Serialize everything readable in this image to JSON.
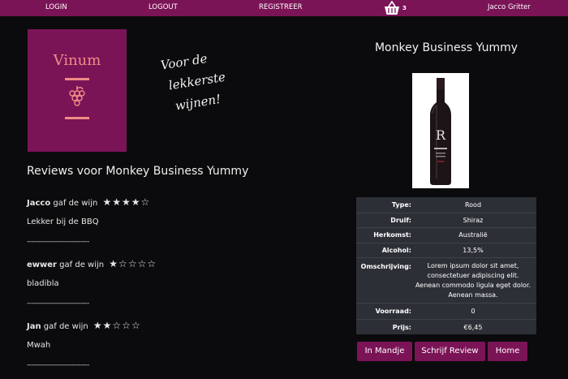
{
  "nav": {
    "login": "LOGIN",
    "logout": "LOGOUT",
    "register": "REGISTREER",
    "cart_count": "3",
    "user_name": "Jacco Gritter"
  },
  "logo": {
    "text": "Vinum"
  },
  "slogan": {
    "lines": [
      "Voor de",
      "lekkerste",
      "wijnen!"
    ]
  },
  "reviews": {
    "title": "Reviews voor Monkey Business Yummy",
    "separator": "----------------------------",
    "items": [
      {
        "user": "Jacco",
        "phrase": "gaf de wijn",
        "stars": "★★★★☆",
        "text": "Lekker bij de BBQ"
      },
      {
        "user": "ewwer",
        "phrase": "gaf de wijn",
        "stars": "★☆☆☆☆",
        "text": "bladibla"
      },
      {
        "user": "Jan",
        "phrase": "gaf de wijn",
        "stars": "★★☆☆☆",
        "text": "Mwah"
      }
    ]
  },
  "product": {
    "title": "Monkey Business Yummy",
    "rows": [
      {
        "label": "Type:",
        "value": "Rood"
      },
      {
        "label": "Druif:",
        "value": "Shiraz"
      },
      {
        "label": "Herkomst:",
        "value": "Australië"
      },
      {
        "label": "Alcohol:",
        "value": "13,5%"
      },
      {
        "label": "Omschrijving:",
        "value": "Lorem ipsum dolor sit amet, consectetuer adipiscing elit. Aenean commodo ligula eget dolor. Aenean massa."
      },
      {
        "label": "Voorraad:",
        "value": "0"
      },
      {
        "label": "Prijs:",
        "value": "€6,45"
      }
    ]
  },
  "buttons": {
    "cart": "In Mandje",
    "review": "Schrijf Review",
    "home": "Home"
  },
  "colors": {
    "brand": "#7b1457",
    "logo_accent": "#f08c86",
    "table_bg": "#2c3036",
    "page_bg": "#0b0a0c"
  }
}
